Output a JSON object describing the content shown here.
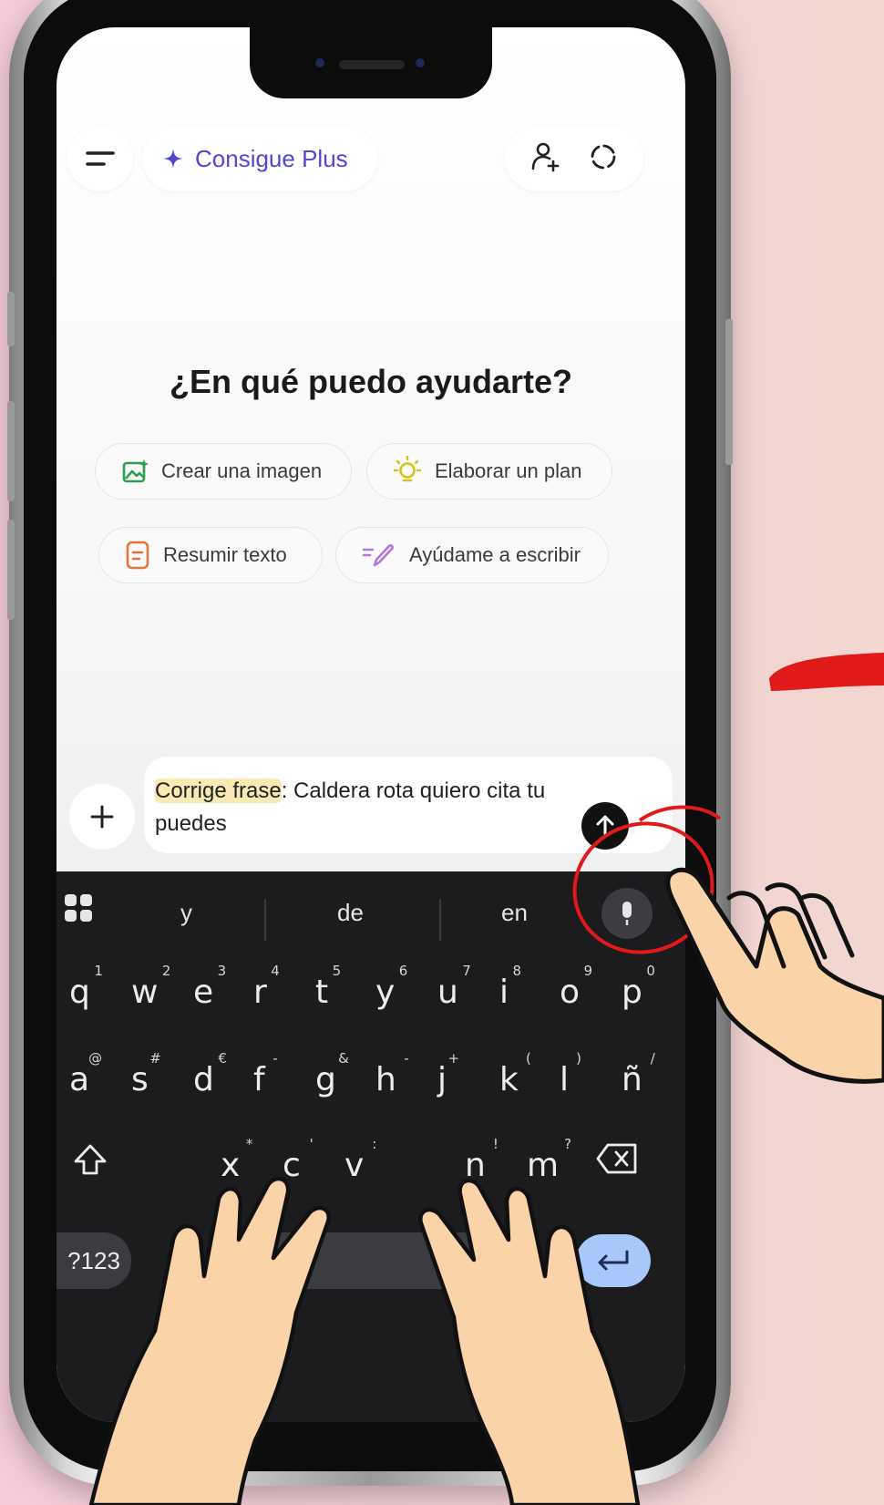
{
  "header": {
    "upgrade_label": "Consigue Plus"
  },
  "main": {
    "heading": "¿En qué puedo ayudarte?",
    "suggestions": [
      {
        "label": "Crear una imagen",
        "icon": "image-sparkle-icon",
        "color": "#2e9e4f"
      },
      {
        "label": "Elaborar un plan",
        "icon": "lightbulb-icon",
        "color": "#d9c21a"
      },
      {
        "label": "Resumir texto",
        "icon": "document-icon",
        "color": "#e2773a"
      },
      {
        "label": "Ayúdame a escribir",
        "icon": "pen-icon",
        "color": "#b07ad6"
      }
    ]
  },
  "composer": {
    "highlighted_text": "Corrige frase",
    "text_after": ": Caldera rota quiero cita tu puedes"
  },
  "keyboard": {
    "suggestions": [
      "y",
      "de",
      "en"
    ],
    "row1": [
      {
        "key": "q",
        "alt": "1"
      },
      {
        "key": "w",
        "alt": "2"
      },
      {
        "key": "e",
        "alt": "3"
      },
      {
        "key": "r",
        "alt": "4"
      },
      {
        "key": "t",
        "alt": "5"
      },
      {
        "key": "y",
        "alt": "6"
      },
      {
        "key": "u",
        "alt": "7"
      },
      {
        "key": "i",
        "alt": "8"
      },
      {
        "key": "o",
        "alt": "9"
      },
      {
        "key": "p",
        "alt": "0"
      }
    ],
    "row2": [
      {
        "key": "a",
        "alt": "@"
      },
      {
        "key": "s",
        "alt": "#"
      },
      {
        "key": "d",
        "alt": "€"
      },
      {
        "key": "f",
        "alt": "-"
      },
      {
        "key": "g",
        "alt": "&"
      },
      {
        "key": "h",
        "alt": "-"
      },
      {
        "key": "j",
        "alt": "+"
      },
      {
        "key": "k",
        "alt": "("
      },
      {
        "key": "l",
        "alt": ")"
      },
      {
        "key": "ñ",
        "alt": "/"
      }
    ],
    "row3_visible": [
      {
        "key": "x",
        "alt": "*"
      },
      {
        "key": "c",
        "alt": "'"
      },
      {
        "key": "v",
        "alt": ":"
      },
      {
        "key": "n",
        "alt": "!"
      },
      {
        "key": "m",
        "alt": "?"
      }
    ],
    "symbols_label": "?123"
  },
  "colors": {
    "accent": "#5145d6",
    "keyboard_bg": "#1c1c1e",
    "enter_key": "#a8c7fa",
    "annotation_red": "#e01a1a",
    "hand_skin": "#fbd3a8"
  }
}
